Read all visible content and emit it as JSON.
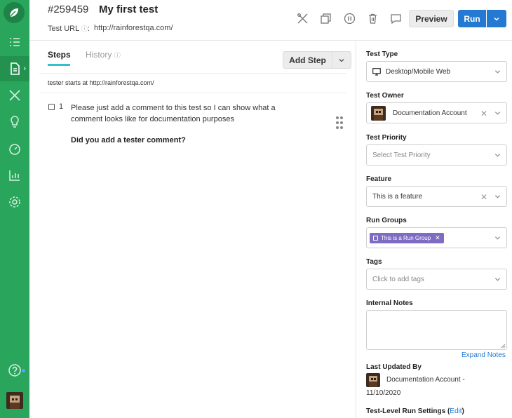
{
  "header": {
    "test_id": "#259459",
    "test_title": "My first test",
    "url_label": "Test URL",
    "url_value": "http://rainforestqa.com/",
    "preview_label": "Preview",
    "run_label": "Run"
  },
  "tabs": {
    "steps": "Steps",
    "history": "History"
  },
  "steps": {
    "add_step_label": "Add Step",
    "starts_text": "tester starts at http://rainforestqa.com/",
    "items": [
      {
        "number": "1",
        "text": "Please just add a comment to this test so I can show what a comment looks like for documentation purposes",
        "question": "Did you add a tester comment?"
      }
    ]
  },
  "panel": {
    "test_type": {
      "label": "Test Type",
      "value": "Desktop/Mobile Web"
    },
    "test_owner": {
      "label": "Test Owner",
      "value": "Documentation Account"
    },
    "test_priority": {
      "label": "Test Priority",
      "placeholder": "Select Test Priority"
    },
    "feature": {
      "label": "Feature",
      "value": "This is a feature"
    },
    "run_groups": {
      "label": "Run Groups",
      "chip": "This is a Run Group"
    },
    "tags": {
      "label": "Tags",
      "placeholder": "Click to add tags"
    },
    "internal_notes": {
      "label": "Internal Notes",
      "expand": "Expand Notes"
    },
    "last_updated": {
      "label": "Last Updated By",
      "line1": "Documentation Account -",
      "line2": "11/10/2020"
    },
    "run_settings": {
      "label": "Test-Level Run Settings (",
      "edit": "Edit",
      "close": ")"
    }
  },
  "colors": {
    "sidebar": "#2aa55c",
    "accent": "#2479d2",
    "tab_underline": "#35c0c9",
    "run_group_chip": "#7d6bc4"
  }
}
